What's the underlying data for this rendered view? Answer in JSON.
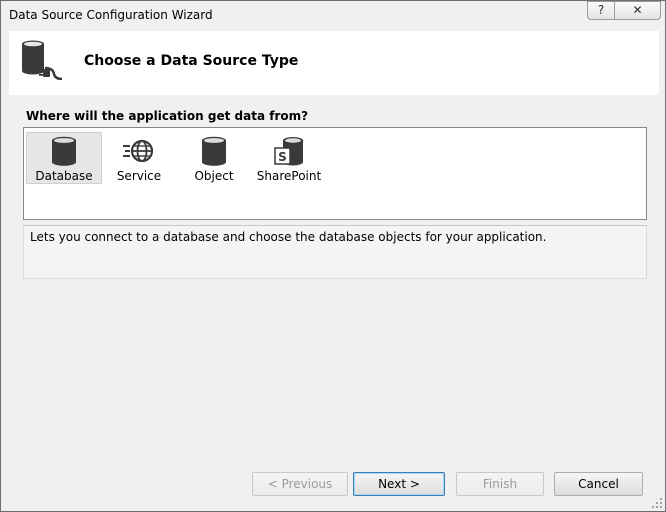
{
  "window": {
    "title": "Data Source Configuration Wizard",
    "help_glyph": "?",
    "close_glyph": "✕"
  },
  "header": {
    "title": "Choose a Data Source Type",
    "icon": "database-connector-icon"
  },
  "content": {
    "question": "Where will the application get data from?",
    "items": [
      {
        "label": "Database",
        "icon": "database-icon",
        "selected": true
      },
      {
        "label": "Service",
        "icon": "service-globe-icon",
        "selected": false
      },
      {
        "label": "Object",
        "icon": "object-icon",
        "selected": false
      },
      {
        "label": "SharePoint",
        "icon": "sharepoint-icon",
        "selected": false
      }
    ],
    "description": "Lets you connect to a database and choose the database objects for your application."
  },
  "buttons": {
    "previous": "< Previous",
    "next": "Next >",
    "finish": "Finish",
    "cancel": "Cancel"
  },
  "colors": {
    "icon_dark": "#3a3a3a",
    "selected_bg": "#e6e6e6",
    "default_button_border": "#3c7fb1"
  }
}
